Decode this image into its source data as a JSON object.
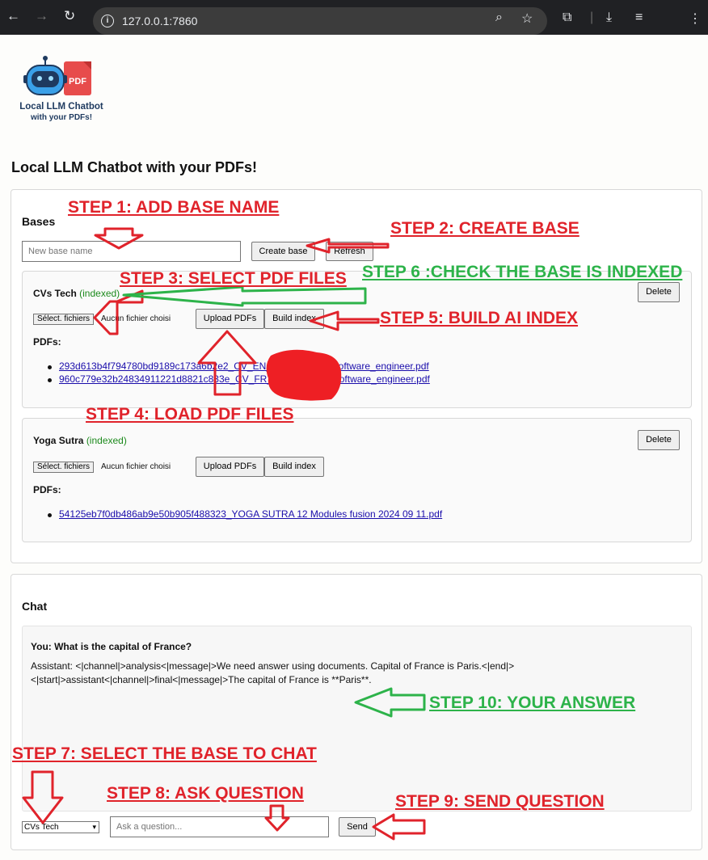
{
  "browser": {
    "url": "127.0.0.1:7860"
  },
  "logo": {
    "text_line1": "Local LLM Chatbot",
    "text_line2": "with your PDFs!",
    "badge": "PDF"
  },
  "page_title": "Local LLM Chatbot with your PDFs!",
  "bases_section": {
    "title": "Bases",
    "new_base_placeholder": "New base name",
    "create_button": "Create base",
    "refresh_button": "Refresh"
  },
  "bases": [
    {
      "name": "CVs Tech",
      "status": "(indexed)",
      "delete_button": "Delete",
      "file_button": "Sélect. fichiers",
      "file_status": "Aucun fichier choisi",
      "upload_button": "Upload PDFs",
      "build_button": "Build index",
      "pdfs_label": "PDFs:",
      "pdfs": [
        "293d613b4f794780bd9189c173a6b2e2_CV_EN_     2025_10_09_software_engineer.pdf",
        "960c779e32b24834911221d8821c833e_CV_FR_     2025_10_09_software_engineer.pdf"
      ]
    },
    {
      "name": "Yoga Sutra",
      "status": "(indexed)",
      "delete_button": "Delete",
      "file_button": "Sélect. fichiers",
      "file_status": "Aucun fichier choisi",
      "upload_button": "Upload PDFs",
      "build_button": "Build index",
      "pdfs_label": "PDFs:",
      "pdfs": [
        "54125eb7f0db486ab9e50b905f488323_YOGA SUTRA 12 Modules fusion 2024 09 11.pdf"
      ]
    }
  ],
  "chat": {
    "title": "Chat",
    "user_message": "You: What is the capital of France?",
    "assistant_line1": "Assistant: <|channel|>analysis<|message|>We need answer using documents. Capital of France is Paris.<|end|>",
    "assistant_line2": "<|start|>assistant<|channel|>final<|message|>The capital of France is **Paris**.",
    "selected_base": "CVs Tech",
    "question_placeholder": "Ask a question...",
    "send_button": "Send"
  },
  "annotations": {
    "step1": "STEP 1: ADD BASE NAME",
    "step2": "STEP 2: CREATE BASE",
    "step3": "STEP 3: SELECT PDF FILES",
    "step4": "STEP 4: LOAD PDF FILES",
    "step5": "STEP 5: BUILD AI INDEX",
    "step6": "STEP 6 :CHECK THE BASE IS INDEXED",
    "step7": "STEP 7: SELECT THE BASE TO CHAT",
    "step8": "STEP 8: ASK QUESTION",
    "step9": "STEP 9: SEND QUESTION",
    "step10": "STEP 10:  YOUR ANSWER"
  },
  "colors": {
    "annotation_red": "#e0232b",
    "annotation_green": "#2db34a",
    "indexed_green": "#1c8a1c",
    "link_blue": "#1a0dab"
  }
}
